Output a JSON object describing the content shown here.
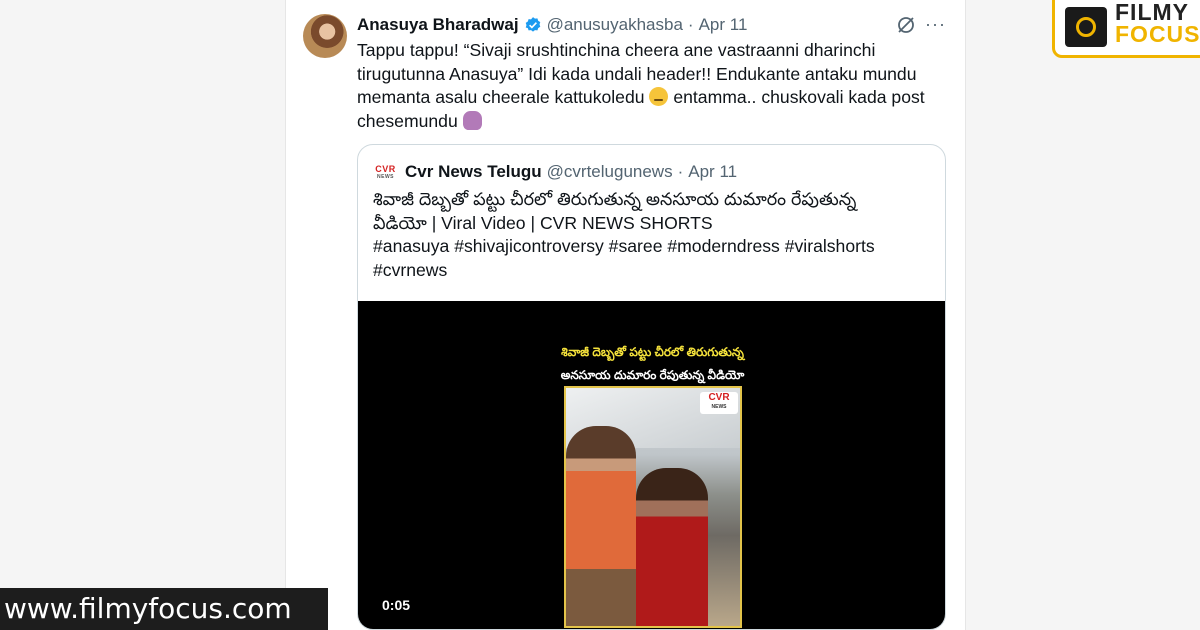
{
  "tweet": {
    "author_name": "Anasuya Bharadwaj",
    "handle": "@anusuyakhasba",
    "separator": "·",
    "date": "Apr 11",
    "more_icon": "···",
    "text_part1": "Tappu tappu! “Sivaji srushtinchina cheera ane vastraanni dharinchi tirugutunna Anasuya” Idi kada undali header!! Endukante antaku mundu memanta asalu cheerale kattukoledu",
    "text_part2": "entamma.. chuskovali kada post chesemundu",
    "emoji1": "face-with-rolling-eyes",
    "emoji2": "woman-facepalming"
  },
  "quote": {
    "logo_text": "CVR",
    "logo_sub": "NEWS",
    "author_name": "Cvr News Telugu",
    "handle": "@cvrtelugunews",
    "separator": "·",
    "date": "Apr 11",
    "text_line1": "శివాజీ దెబ్బతో పట్టు చీరలో తిరుగుతున్న అనసూయ దుమారం రేపుతున్న",
    "text_line2": "వీడియో | Viral Video | CVR NEWS SHORTS",
    "text_line3": "#anasuya #shivajicontroversy #saree #moderndress #viralshorts",
    "text_line4": "#cvrnews"
  },
  "video": {
    "caption1": "శివాజీ దెబ్బతో పట్టు చీరలో తిరుగుతున్న",
    "caption2": "అనసూయ దుమారం రేపుతున్న వీడియో",
    "frame_logo": "CVR",
    "frame_logo_sub": "NEWS",
    "timestamp": "0:05"
  },
  "watermark": {
    "site": "www.filmyfocus.com",
    "logo_line1": "FILMY",
    "logo_line2": "FOCUS"
  },
  "colors": {
    "verified": "#1d9bf0",
    "secondary_text": "#536471",
    "caption_yellow": "#f5e23b",
    "logo_orange": "#f0b400",
    "cvr_red": "#d42121"
  }
}
